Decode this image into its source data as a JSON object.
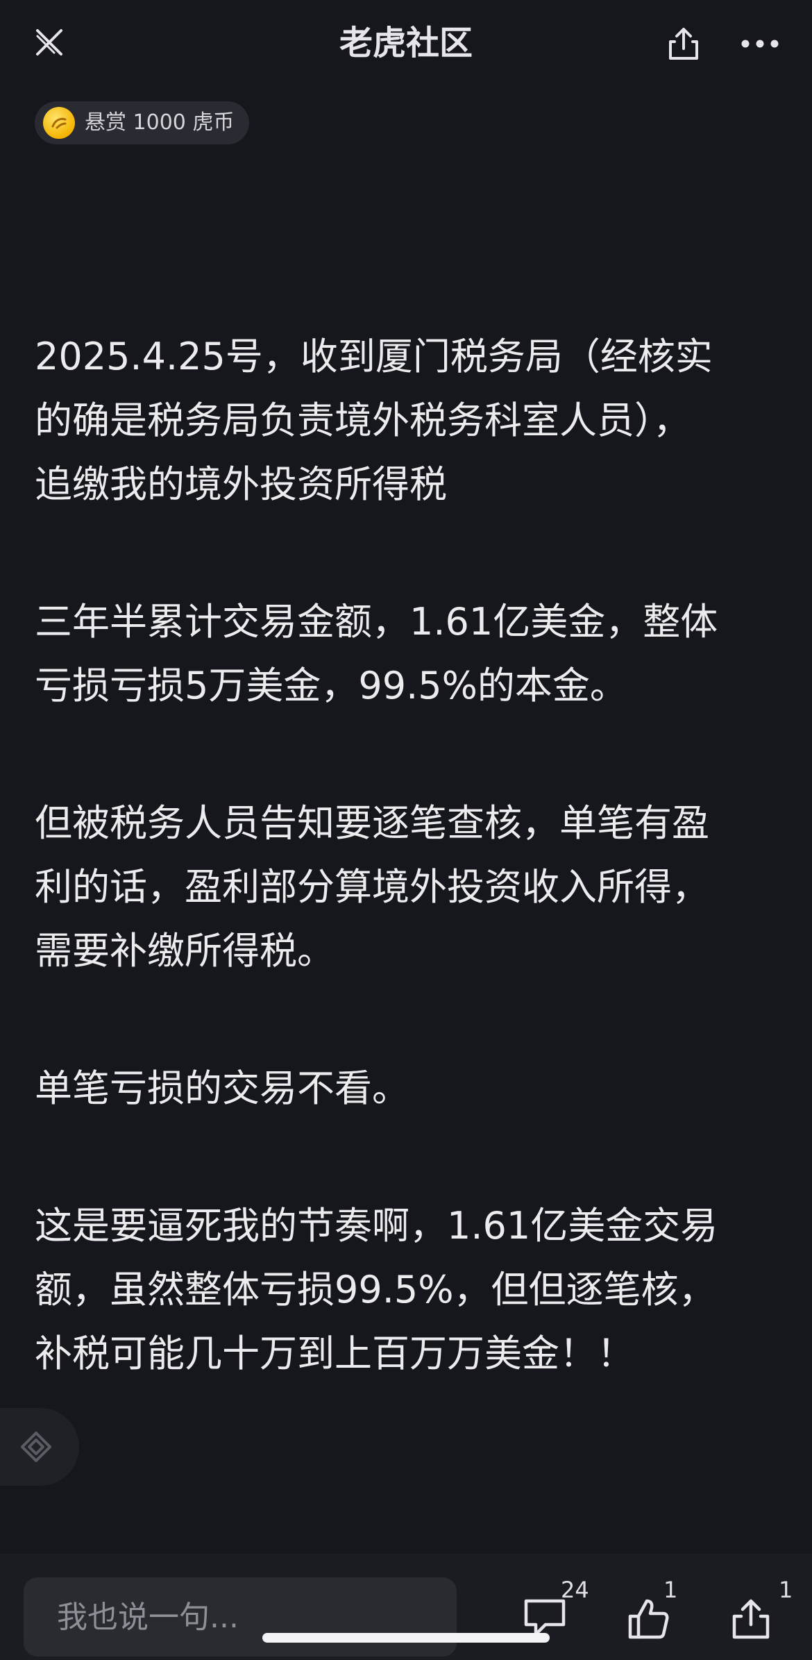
{
  "header": {
    "title": "老虎社区",
    "close_icon": "close-x-icon",
    "share_icon": "share-icon",
    "more_icon": "more-dots-icon"
  },
  "bounty": {
    "label": "悬赏 1000 虎币",
    "icon": "coin-icon"
  },
  "article": {
    "paragraphs": [
      "2025.4.25号，收到厦门税务局（经核实\n的确是税务局负责境外税务科室人员），\n追缴我的境外投资所得税",
      "三年半累计交易金额，1.61亿美金，整体\n亏损亏损5万美金，99.5%的本金。",
      "但被税务人员告知要逐笔查核，单笔有盈\n利的话，盈利部分算境外投资收入所得，\n需要补缴所得税。",
      "单笔亏损的交易不看。",
      "这是要逼死我的节奏啊，1.61亿美金交易\n额，虽然整体亏损99.5%，但但逐笔核，\n补税可能几十万到上百万万美金！！"
    ]
  },
  "bottom_bar": {
    "comment_placeholder": "我也说一句...",
    "comment_count": "24",
    "like_count": "1",
    "share_count": "1"
  },
  "colors": {
    "background": "#16171c",
    "text": "#ececef",
    "coin": "#f4b400"
  }
}
